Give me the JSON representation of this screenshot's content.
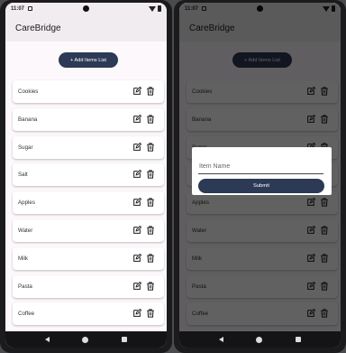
{
  "status": {
    "time": "11:07"
  },
  "app": {
    "title": "CareBridge"
  },
  "actions": {
    "add_label": "+ Add Items List"
  },
  "items": [
    {
      "label": "Cookies"
    },
    {
      "label": "Banana"
    },
    {
      "label": "Sugar"
    },
    {
      "label": "Salt"
    },
    {
      "label": "Apples"
    },
    {
      "label": "Water"
    },
    {
      "label": "Milk"
    },
    {
      "label": "Pasta"
    },
    {
      "label": "Coffee"
    }
  ],
  "dialog": {
    "placeholder": "Item Name",
    "submit_label": "Submit"
  },
  "icons": {
    "edit": "edit-icon",
    "delete": "trash-icon"
  },
  "colors": {
    "accent": "#2d3a55",
    "appbar": "#f0ecf0",
    "background": "#fcf8fc"
  }
}
